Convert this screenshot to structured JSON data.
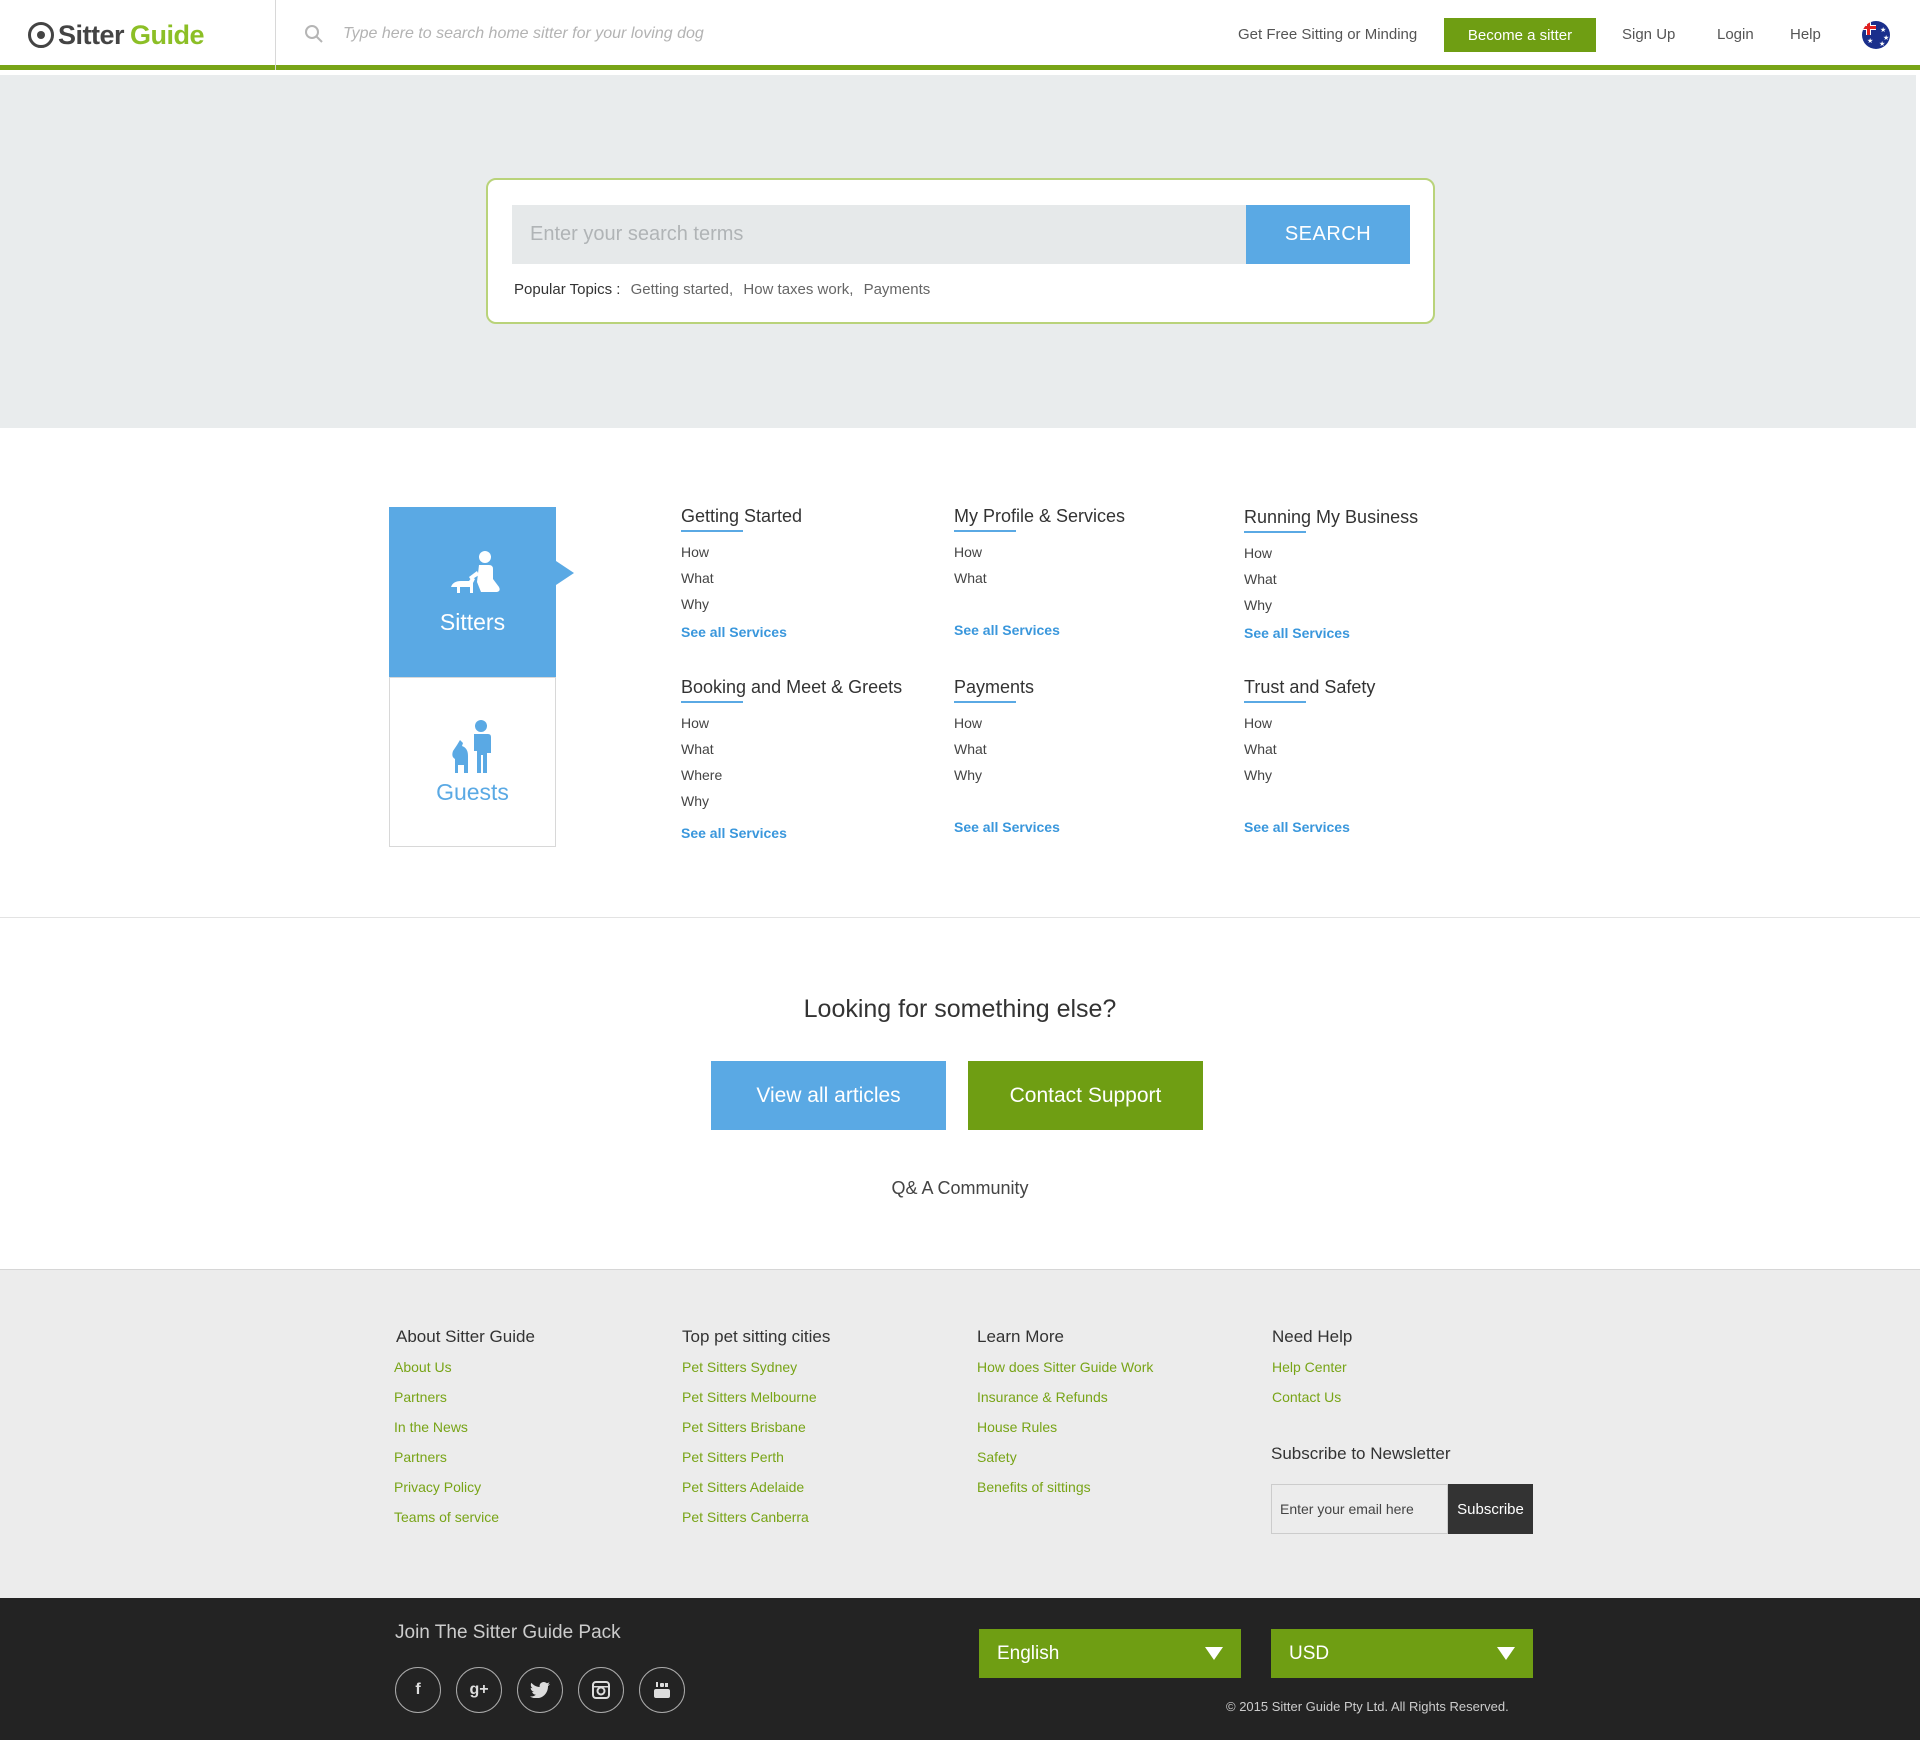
{
  "header": {
    "logo_word1": "Sitter",
    "logo_word2": "Guide",
    "search_placeholder": "Type here to search home sitter for your loving dog",
    "nav": {
      "free": "Get Free Sitting or Minding",
      "become": "Become a sitter",
      "signup": "Sign Up",
      "login": "Login",
      "help": "Help"
    }
  },
  "hero": {
    "search_placeholder": "Enter your search terms",
    "search_button": "SEARCH",
    "popular_label": "Popular Topics :",
    "popular_topics": [
      "Getting started,",
      "How taxes work,",
      "Payments"
    ]
  },
  "tabs": {
    "sitters": "Sitters",
    "guests": "Guests"
  },
  "topics": [
    {
      "title": "Getting Started",
      "links": [
        "How",
        "What",
        "Why"
      ],
      "see_all": "See all Services"
    },
    {
      "title": "My Profile & Services",
      "links": [
        "How",
        "What"
      ],
      "see_all": "See all Services"
    },
    {
      "title": "Running My Business",
      "links": [
        "How",
        "What",
        "Why"
      ],
      "see_all": "See all Services"
    },
    {
      "title": "Booking and Meet & Greets",
      "links": [
        "How",
        "What",
        "Where",
        "Why"
      ],
      "see_all": "See all Services"
    },
    {
      "title": "Payments",
      "links": [
        "How",
        "What",
        "Why"
      ],
      "see_all": "See all Services"
    },
    {
      "title": "Trust and Safety",
      "links": [
        "How",
        "What",
        "Why"
      ],
      "see_all": "See all Services"
    }
  ],
  "cta": {
    "heading": "Looking for something else?",
    "view_articles": "View all articles",
    "contact_support": "Contact Support",
    "community": "Q& A Community"
  },
  "footer": {
    "about": {
      "title": "About Sitter Guide",
      "links": [
        "About Us",
        "Partners",
        "In the News",
        "Partners",
        "Privacy Policy",
        "Teams of service"
      ]
    },
    "cities": {
      "title": "Top pet sitting cities",
      "links": [
        "Pet Sitters Sydney",
        "Pet Sitters Melbourne",
        "Pet Sitters Brisbane",
        "Pet Sitters Perth",
        "Pet Sitters Adelaide",
        "Pet Sitters Canberra"
      ]
    },
    "learn": {
      "title": "Learn More",
      "links": [
        "How does Sitter Guide Work",
        "Insurance & Refunds",
        "House Rules",
        "Safety",
        "Benefits of sittings"
      ]
    },
    "help": {
      "title": "Need Help",
      "links": [
        "Help Center",
        "Contact Us"
      ]
    },
    "newsletter": {
      "title": "Subscribe to Newsletter",
      "placeholder": "Enter your email here",
      "button": "Subscribe"
    },
    "join": "Join The Sitter Guide Pack",
    "social_icons": [
      "facebook-icon",
      "google-plus-icon",
      "twitter-icon",
      "instagram-icon",
      "youtube-icon"
    ],
    "language": "English",
    "currency": "USD",
    "copyright": "© 2015 Sitter Guide Pty Ltd. All Rights Reserved."
  },
  "colors": {
    "brand_green": "#6f9e13",
    "brand_blue": "#5aa9e4",
    "link_green": "#78a417"
  }
}
